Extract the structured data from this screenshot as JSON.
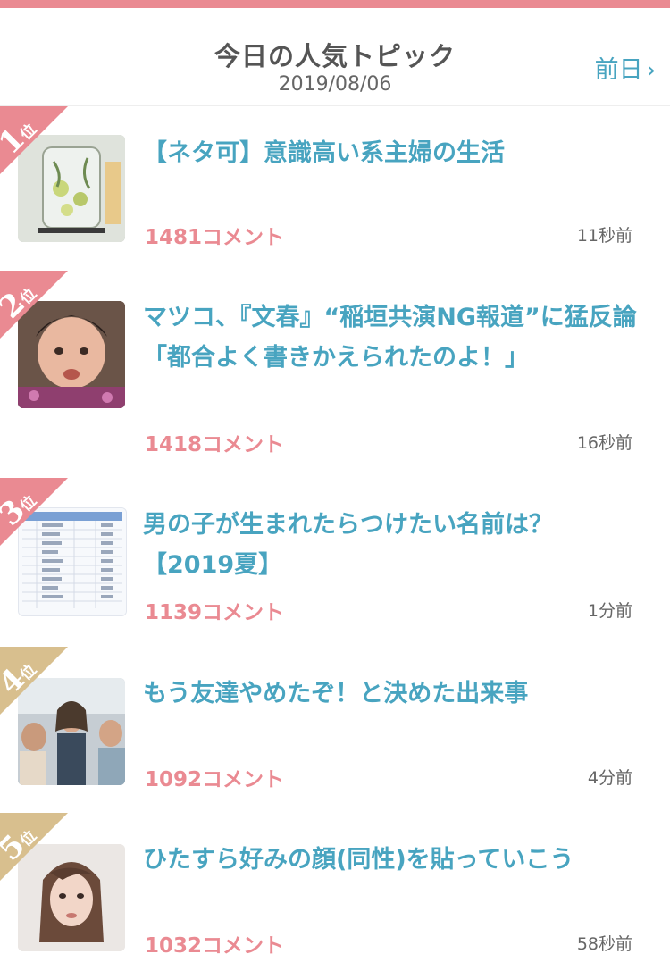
{
  "header": {
    "title": "今日の人気トピック",
    "date": "2019/08/06",
    "prev_label": "前日"
  },
  "colors": {
    "accent_blue": "#48a4c0",
    "accent_pink": "#ea8a92",
    "rank_1_2_3": "#ea8a92",
    "rank_4_5": "#d8bf8e"
  },
  "topics": [
    {
      "rank": "1",
      "rank_suffix": "位",
      "title": "【ネタ可】意識高い系主婦の生活",
      "comments": "1481コメント",
      "time": "11秒前",
      "thumb_icon": "drink-dispenser-photo"
    },
    {
      "rank": "2",
      "rank_suffix": "位",
      "title": "マツコ、『文春』“稲垣共演NG報道”に猛反論 「都合よく書きかえられたのよ！」",
      "comments": "1418コメント",
      "time": "16秒前",
      "thumb_icon": "person-photo"
    },
    {
      "rank": "3",
      "rank_suffix": "位",
      "title": "男の子が生まれたらつけたい名前は？【2019夏】",
      "comments": "1139コメント",
      "time": "1分前",
      "thumb_icon": "ranking-table-image"
    },
    {
      "rank": "4",
      "rank_suffix": "位",
      "title": "もう友達やめたぞ！と決めた出来事",
      "comments": "1092コメント",
      "time": "4分前",
      "thumb_icon": "friends-photo"
    },
    {
      "rank": "5",
      "rank_suffix": "位",
      "title": "ひたすら好みの顔(同性)を貼っていこう",
      "comments": "1032コメント",
      "time": "58秒前",
      "thumb_icon": "portrait-photo"
    }
  ]
}
